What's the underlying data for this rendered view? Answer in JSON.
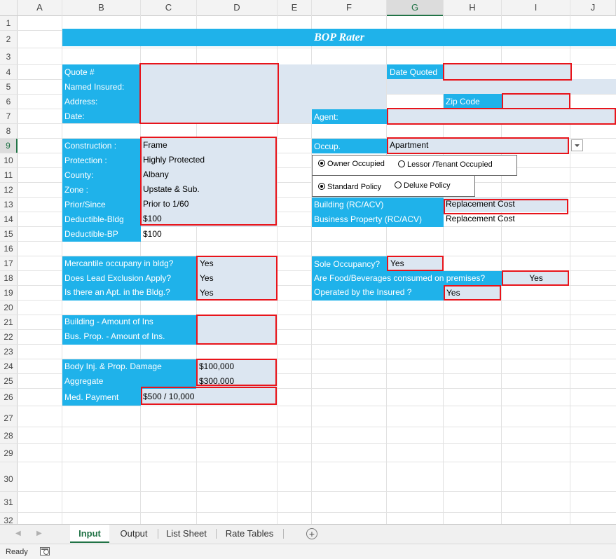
{
  "columns": [
    "A",
    "B",
    "C",
    "D",
    "E",
    "F",
    "G",
    "H",
    "I",
    "J"
  ],
  "rows": [
    "1",
    "2",
    "3",
    "4",
    "5",
    "6",
    "7",
    "8",
    "9",
    "10",
    "11",
    "12",
    "13",
    "14",
    "15",
    "16",
    "17",
    "18",
    "19",
    "20",
    "21",
    "22",
    "23",
    "24",
    "25",
    "26",
    "27",
    "28",
    "29",
    "30",
    "31",
    "32"
  ],
  "title": "BOP Rater",
  "labels": {
    "quote": "Quote #",
    "named_insured": "Named Insured:",
    "address": "Address:",
    "date": "Date:",
    "date_quoted": "Date Quoted",
    "zip_code": "Zip Code",
    "agent": "Agent:",
    "construction": "Construction :",
    "protection": "Protection :",
    "county": "County:",
    "zone": "Zone :",
    "prior_since": "Prior/Since",
    "deductible_bldg": "Deductible-Bldg",
    "deductible_bp": "Deductible-BP",
    "occup": "Occup.",
    "building_rc": "Building (RC/ACV)",
    "business_property_rc": "Business Property (RC/ACV)",
    "mercantile": "Mercantile occupany in bldg?",
    "lead_exclusion": "Does Lead Exclusion Apply?",
    "apt_in_bldg": "Is there an Apt. in the Bldg.?",
    "sole_occupancy": "Sole Occupancy?",
    "food_beverages": "Are Food/Beverages consumed on premises?",
    "operated_by": "Operated by  the Insured ?",
    "building_amount": "Building - Amount of Ins",
    "bus_prop_amount": "Bus. Prop. - Amount of Ins.",
    "body_inj": "Body Inj. & Prop. Damage",
    "aggregate": "Aggregate",
    "med_payment": "Med. Payment"
  },
  "values": {
    "construction": "Frame",
    "protection": "Highly Protected",
    "county": "Albany",
    "zone": "Upstate & Sub.",
    "prior_since": "Prior to 1/60",
    "deductible_bldg": "$100",
    "deductible_bp": "$100",
    "occup": "Apartment",
    "building_rc": "Replacement Cost",
    "business_property_rc": "Replacement Cost",
    "mercantile": "Yes",
    "lead_exclusion": "Yes",
    "apt_in_bldg": "Yes",
    "sole_occupancy": "Yes",
    "food_beverages": "Yes",
    "operated_by": "Yes",
    "body_inj": "$100,000",
    "aggregate": "$300,000",
    "med_payment": "$500 / 10,000"
  },
  "occupancy_options": {
    "owner": "Owner Occupied",
    "lessor": "Lessor /Tenant Occupied",
    "selected": "owner"
  },
  "policy_options": {
    "standard": "Standard Policy",
    "deluxe": "Deluxe Policy",
    "selected": "standard"
  },
  "dropdown_icon": "chevron-down-icon",
  "sheet_tabs": [
    "Input",
    "Output",
    "List Sheet",
    "Rate Tables"
  ],
  "active_tab": "Input",
  "status": {
    "ready": "Ready"
  },
  "colors": {
    "label_blue": "#1fb2ea",
    "input_fill": "#dce6f1",
    "required_border": "#e8141b",
    "accent": "#217346"
  }
}
